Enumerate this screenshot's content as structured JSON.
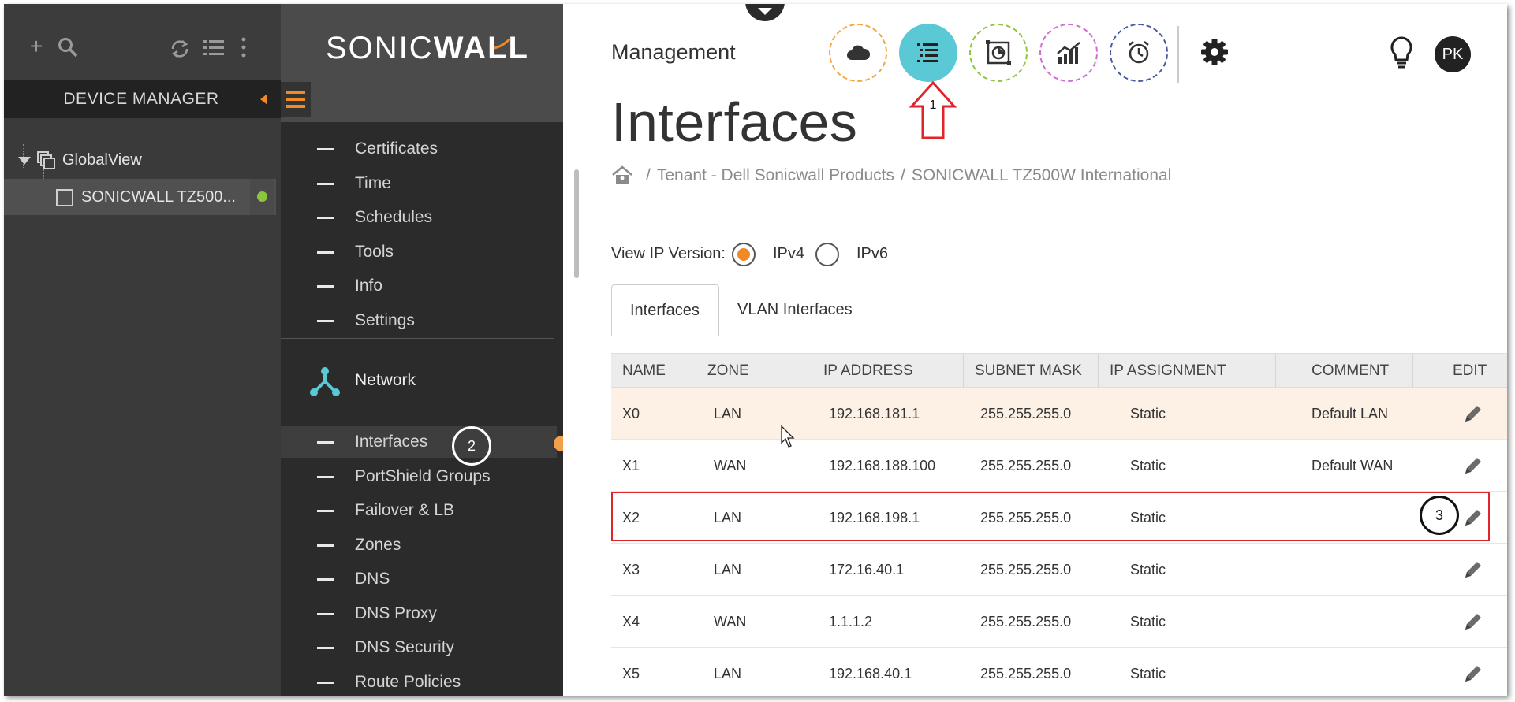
{
  "device_manager": {
    "title": "DEVICE MANAGER",
    "tree": [
      {
        "label": "GlobalView"
      },
      {
        "label": "SONICWALL TZ500..."
      }
    ]
  },
  "brand": {
    "logo_light": "SONIC",
    "logo_bold": "WALL"
  },
  "nav": {
    "items_top": [
      "Certificates",
      "Time",
      "Schedules",
      "Tools",
      "Info",
      "Settings"
    ],
    "section": "Network",
    "items_network": [
      "Interfaces",
      "PortShield Groups",
      "Failover & LB",
      "Zones",
      "DNS",
      "DNS Proxy",
      "DNS Security",
      "Route Policies"
    ]
  },
  "header": {
    "title": "Management",
    "avatar": "PK",
    "icons": [
      "cloud-icon",
      "list-icon",
      "report-icon",
      "analytics-icon",
      "clock-icon",
      "gear-icon",
      "lightbulb-icon"
    ],
    "accent": "#5bc8d6"
  },
  "page": {
    "title": "Interfaces",
    "breadcrumb": [
      "Tenant - Dell Sonicwall Products",
      "SONICWALL TZ500W International"
    ],
    "ip_version_label": "View IP Version:",
    "ipv4": "IPv4",
    "ipv6": "IPv6",
    "tabs": [
      "Interfaces",
      "VLAN Interfaces"
    ]
  },
  "table": {
    "columns": [
      "NAME",
      "ZONE",
      "IP ADDRESS",
      "SUBNET MASK",
      "IP ASSIGNMENT",
      "COMMENT",
      "EDIT"
    ],
    "rows": [
      {
        "name": "X0",
        "zone": "LAN",
        "ip": "192.168.181.1",
        "mask": "255.255.255.0",
        "assign": "Static",
        "comment": "Default LAN"
      },
      {
        "name": "X1",
        "zone": "WAN",
        "ip": "192.168.188.100",
        "mask": "255.255.255.0",
        "assign": "Static",
        "comment": "Default WAN"
      },
      {
        "name": "X2",
        "zone": "LAN",
        "ip": "192.168.198.1",
        "mask": "255.255.255.0",
        "assign": "Static",
        "comment": ""
      },
      {
        "name": "X3",
        "zone": "LAN",
        "ip": "172.16.40.1",
        "mask": "255.255.255.0",
        "assign": "Static",
        "comment": ""
      },
      {
        "name": "X4",
        "zone": "WAN",
        "ip": "1.1.1.2",
        "mask": "255.255.255.0",
        "assign": "Static",
        "comment": ""
      },
      {
        "name": "X5",
        "zone": "LAN",
        "ip": "192.168.40.1",
        "mask": "255.255.255.0",
        "assign": "Static",
        "comment": ""
      }
    ]
  },
  "annotations": {
    "step1": "1",
    "step2": "2",
    "step3": "3"
  },
  "colors": {
    "accent_orange": "#f08a24",
    "highlight_red": "#e0242a",
    "status_green": "#8cc63f"
  }
}
